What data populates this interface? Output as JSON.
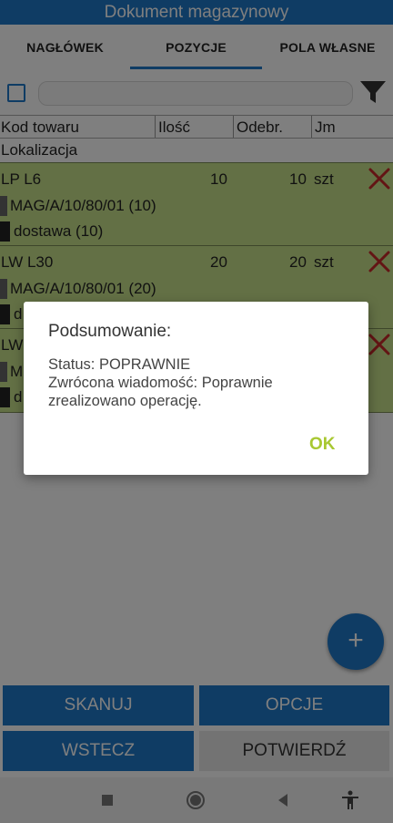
{
  "app": {
    "title": "Dokument magazynowy"
  },
  "tabs": [
    {
      "label": "NAGŁÓWEK",
      "active": false
    },
    {
      "label": "POZYCJE",
      "active": true
    },
    {
      "label": "POLA WŁASNE",
      "active": false
    }
  ],
  "filter": {
    "checked": false,
    "search_value": "",
    "search_placeholder": ""
  },
  "columns": {
    "code": "Kod towaru",
    "qty": "Ilość",
    "received": "Odebr.",
    "unit": "Jm",
    "location": "Lokalizacja"
  },
  "rows": [
    {
      "code": "LP L6",
      "qty": "10",
      "received": "10",
      "unit": "szt",
      "location": "MAG/A/10/80/01 (10)",
      "delivery": "dostawa (10)",
      "delete_icon": "close-x-icon"
    },
    {
      "code": "LW L30",
      "qty": "20",
      "received": "20",
      "unit": "szt",
      "location": "MAG/A/10/80/01 (20)",
      "delivery": "d",
      "delete_icon": "close-x-icon"
    },
    {
      "code": "LW",
      "qty": "",
      "received": "",
      "unit": "",
      "location": "M",
      "delivery": "d",
      "delete_icon": "close-x-icon"
    }
  ],
  "fab": {
    "label": "+",
    "icon": "plus-icon"
  },
  "buttons": {
    "scan": "SKANUJ",
    "options": "OPCJE",
    "back": "WSTECZ",
    "confirm": "POTWIERDŹ"
  },
  "dialog": {
    "title": "Podsumowanie:",
    "message": "Status: POPRAWNIE\nZwrócona wiadomość: Poprawnie zrealizowano operację.",
    "ok": "OK"
  },
  "colors": {
    "primary": "#1f78c8",
    "row_bg": "#c6e08a",
    "delete": "#c62828",
    "ok": "#a8c832"
  }
}
